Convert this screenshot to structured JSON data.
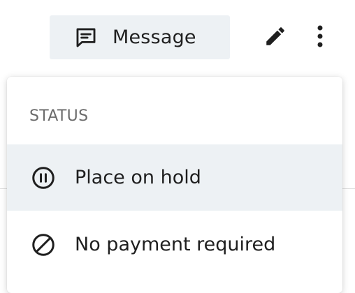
{
  "toolbar": {
    "message_label": "Message",
    "message_icon": "chat-bubble-icon",
    "edit_icon": "pencil-icon",
    "more_icon": "more-vertical-icon"
  },
  "menu": {
    "section_title": "STATUS",
    "items": [
      {
        "label": "Place on hold",
        "icon": "pause-circle-icon",
        "highlighted": true
      },
      {
        "label": "No payment required",
        "icon": "block-icon",
        "highlighted": false
      }
    ]
  },
  "colors": {
    "button_bg": "#edf1f4",
    "highlight_bg": "#edf1f4",
    "text": "#1f1f1f",
    "muted_text": "#6b6b6b"
  }
}
